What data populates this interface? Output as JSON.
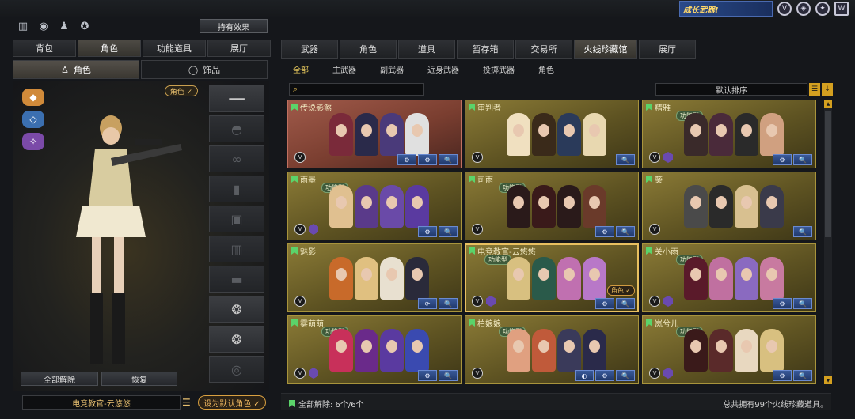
{
  "header": {
    "promo": "成长武器!",
    "icons": [
      "promo-weapon-icon",
      "v-badge-icon",
      "shield-icon",
      "wing-icon",
      "w-logo-icon"
    ]
  },
  "left": {
    "top_icons": [
      "ranking-icon",
      "target-icon",
      "person-add-icon",
      "bag-icon"
    ],
    "effect_button": "持有效果",
    "tabs": [
      "背包",
      "角色",
      "功能道具",
      "展厅"
    ],
    "active_tab": 1,
    "subtabs": [
      "角色",
      "饰品"
    ],
    "role_badge": "角色 ✓",
    "unlock_all": "全部解除",
    "restore": "恢复",
    "character_name": "电竞教官-云悠悠",
    "set_default": "设为默认角色 ✓"
  },
  "right": {
    "tabs": [
      "武器",
      "角色",
      "道具",
      "暂存箱",
      "交易所",
      "火线珍藏馆",
      "展厅"
    ],
    "active_tab": 5,
    "filters": [
      "全部",
      "主武器",
      "副武器",
      "近身武器",
      "投掷武器",
      "角色"
    ],
    "active_filter": 0,
    "sort_label": "默认排序",
    "cards": [
      {
        "title": "传说影煞",
        "tag": "",
        "faces": [
          "#7a2a3a",
          "#2a2a4a",
          "#4a3a7a",
          "#e0e0e0"
        ],
        "style": "red",
        "vb": true,
        "hx": false,
        "acts": [
          "⚙",
          "⚙",
          "🔍"
        ],
        "role": ""
      },
      {
        "title": "审判者",
        "tag": "",
        "faces": [
          "#f0e0c0",
          "#3a2a1a",
          "#2a3a5a",
          "#e8d8b0"
        ],
        "style": "gold",
        "vb": true,
        "hx": false,
        "acts": [
          "🔍"
        ],
        "role": ""
      },
      {
        "title": "精雅",
        "tag": "功能型",
        "faces": [
          "#3a2a2a",
          "#4a2a3a",
          "#2a2a2a",
          "#d0a080"
        ],
        "style": "gold",
        "vb": true,
        "hx": true,
        "acts": [
          "⚙",
          "🔍"
        ],
        "role": ""
      },
      {
        "title": "雨墨",
        "tag": "功能型",
        "faces": [
          "#e0c090",
          "#5a3a8a",
          "#6a4aa8",
          "#5a3aa0"
        ],
        "style": "gold",
        "vb": true,
        "hx": true,
        "acts": [
          "⚙",
          "🔍"
        ],
        "role": ""
      },
      {
        "title": "司雨",
        "tag": "功能型",
        "faces": [
          "#2a1a1a",
          "#3a1a1a",
          "#2a1a1a",
          "#6a3a2a"
        ],
        "style": "gold",
        "vb": true,
        "hx": false,
        "acts": [
          "⚙",
          "🔍"
        ],
        "role": ""
      },
      {
        "title": "葵",
        "tag": "",
        "faces": [
          "#4a4a4a",
          "#2a2a2a",
          "#d8c090",
          "#3a3a4a"
        ],
        "style": "gold",
        "vb": true,
        "hx": false,
        "acts": [
          "🔍"
        ],
        "role": ""
      },
      {
        "title": "魅影",
        "tag": "",
        "faces": [
          "#c86a2a",
          "#e0c080",
          "#e8e0d0",
          "#2a2a3a"
        ],
        "style": "gold",
        "vb": true,
        "hx": false,
        "acts": [
          "⟳",
          "🔍"
        ],
        "role": ""
      },
      {
        "title": "电竞教官-云悠悠",
        "tag": "功能型",
        "faces": [
          "#d8c080",
          "#2a5a4a",
          "#c070b0",
          "#b878c8"
        ],
        "style": "sel",
        "vb": true,
        "hx": true,
        "acts": [
          "⚙",
          "🔍"
        ],
        "role": "角色 ✓"
      },
      {
        "title": "关小雨",
        "tag": "功能型",
        "faces": [
          "#5a1a2a",
          "#c070a0",
          "#8a6ac0",
          "#c87aa0"
        ],
        "style": "gold",
        "vb": true,
        "hx": true,
        "acts": [
          "⚙",
          "🔍"
        ],
        "role": ""
      },
      {
        "title": "雾萌萌",
        "tag": "功能型",
        "faces": [
          "#c8305a",
          "#6a2a8a",
          "#5a3aa0",
          "#3a4ab0"
        ],
        "style": "gold",
        "vb": true,
        "hx": true,
        "acts": [
          "⚙",
          "🔍"
        ],
        "role": ""
      },
      {
        "title": "柏娘娘",
        "tag": "功能型",
        "faces": [
          "#e0a080",
          "#c05a3a",
          "#3a3a5a",
          "#2a2a4a"
        ],
        "style": "gold",
        "vb": true,
        "hx": false,
        "acts": [
          "◐",
          "⚙",
          "🔍"
        ],
        "role": ""
      },
      {
        "title": "岚兮儿",
        "tag": "功能型",
        "faces": [
          "#3a1a1a",
          "#5a2a2a",
          "#e8d8c0",
          "#d8c080"
        ],
        "style": "gold",
        "vb": true,
        "hx": true,
        "acts": [
          "⚙",
          "🔍"
        ],
        "role": ""
      }
    ],
    "bottom_left": "全部解除: 6个/6个",
    "bottom_right": "总共拥有99个火线珍藏道具。"
  }
}
